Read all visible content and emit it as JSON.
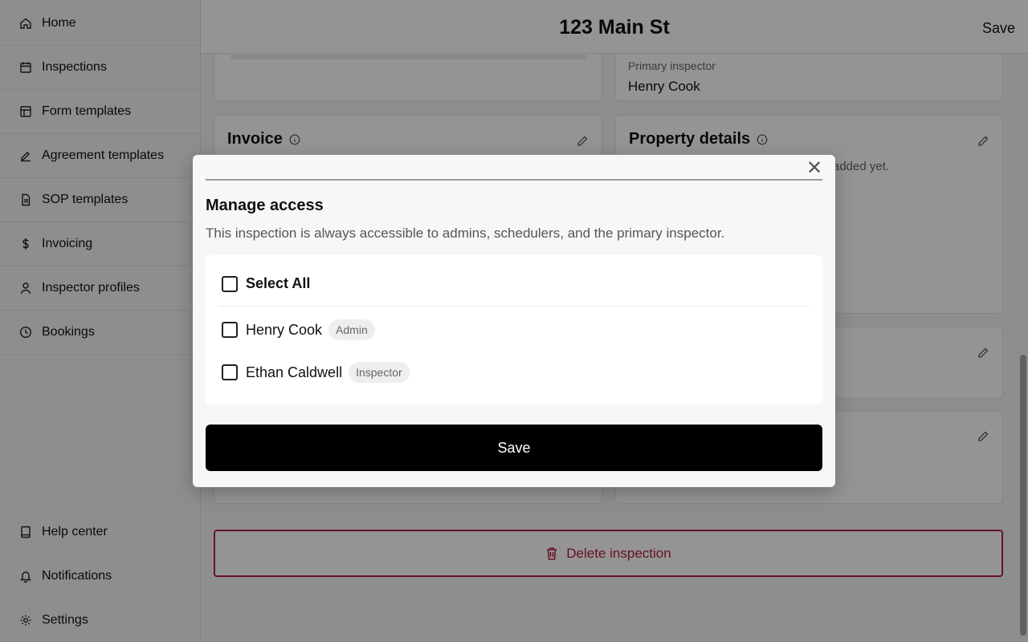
{
  "sidebar": {
    "items": [
      {
        "label": "Home",
        "icon": "home-icon"
      },
      {
        "label": "Inspections",
        "icon": "calendar-icon"
      },
      {
        "label": "Form templates",
        "icon": "layout-icon"
      },
      {
        "label": "Agreement templates",
        "icon": "signature-icon"
      },
      {
        "label": "SOP templates",
        "icon": "document-icon"
      },
      {
        "label": "Invoicing",
        "icon": "dollar-icon"
      },
      {
        "label": "Inspector profiles",
        "icon": "user-icon"
      },
      {
        "label": "Bookings",
        "icon": "clock-icon"
      }
    ],
    "bottom_items": [
      {
        "label": "Help center",
        "icon": "book-icon"
      },
      {
        "label": "Notifications",
        "icon": "bell-icon"
      },
      {
        "label": "Settings",
        "icon": "gear-icon"
      }
    ]
  },
  "header": {
    "title": "123 Main St",
    "save_label": "Save"
  },
  "main": {
    "primary_inspector_label": "Primary inspector",
    "primary_inspector_value": "Henry Cook",
    "invoice_title": "Invoice",
    "property_details_title": "Property details",
    "property_details_empty": "added yet.",
    "delete_label": "Delete inspection"
  },
  "modal": {
    "title": "Manage access",
    "subtitle": "This inspection is always accessible to admins, schedulers, and the primary inspector.",
    "select_all_label": "Select All",
    "people": [
      {
        "name": "Henry Cook",
        "role": "Admin"
      },
      {
        "name": "Ethan Caldwell",
        "role": "Inspector"
      }
    ],
    "save_label": "Save",
    "close_glyph": "✕"
  },
  "colors": {
    "danger": "#b11f3b",
    "primary_button": "#000000"
  }
}
